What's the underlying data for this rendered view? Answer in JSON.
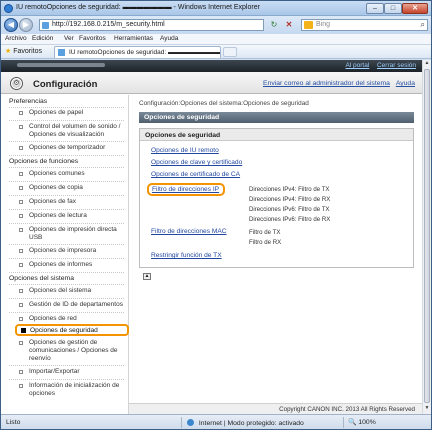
{
  "window": {
    "title": "IU remotoOpciones de seguridad: ▬▬▬▬▬▬▬ - Windows Internet Explorer",
    "min": "–",
    "max": "□",
    "close": "✕"
  },
  "address": {
    "back": "◀",
    "forward": "▶",
    "url": "http://192.168.0.215/m_security.html",
    "refresh": "↻",
    "stop": "✕",
    "search_placeholder": "Bing",
    "search_icon": "⌕"
  },
  "menu": [
    "Archivo",
    "Edición",
    "Ver",
    "Favoritos",
    "Herramientas",
    "Ayuda"
  ],
  "favorites": {
    "label": "Favoritos",
    "tab_title": "IU remotoOpciones de seguridad: ▬▬▬▬▬▬▬▬"
  },
  "topbar": {
    "portal": "Al portal",
    "logout": "Cerrar sesión"
  },
  "app": {
    "title": "Configuración",
    "email_admin": "Enviar correo al administrador del sistema",
    "help": "Ayuda"
  },
  "nav": {
    "preferences": "Preferencias",
    "paper": "Opciones de papel",
    "volume": "Control del volumen de sonido / Opciones de visualización",
    "timer": "Opciones de temporizador",
    "function_settings": "Opciones de funciones",
    "common": "Opciones comunes",
    "copy": "Opciones de copia",
    "fax": "Opciones de fax",
    "read": "Opciones de lectura",
    "usb": "Opciones de impresión directa USB",
    "printer": "Opciones de impresora",
    "reports": "Opciones de informes",
    "system_settings": "Opciones del sistema",
    "system": "Opciones del sistema",
    "dept_id": "Gestión de ID de departamentos",
    "network": "Opciones de red",
    "security": "Opciones de seguridad",
    "comm_mgmt": "Opciones de gestión de comunicaciones / Opciones de reenvío",
    "import_export": "Importar/Exportar",
    "init_info": "Información de inicialización de opciones"
  },
  "content": {
    "breadcrumb": "Configuración:Opciones del sistema:Opciones de seguridad",
    "page_title": "Opciones de seguridad",
    "box_title": "Opciones de seguridad",
    "links": {
      "remote_ui": "Opciones de IU remoto",
      "key_cert": "Opciones de clave y certificado",
      "ca_cert": "Opciones de certificado de CA",
      "ip_filter": "Filtro de direcciones IP",
      "mac_filter": "Filtro de direcciones MAC",
      "restrict_tx": "Restringir función de TX"
    },
    "ip_filters": [
      "Direcciones IPv4: Filtro de TX",
      "Direcciones IPv4: Filtro de RX",
      "Direcciones IPv6: Filtro de TX",
      "Direcciones IPv6: Filtro de RX"
    ],
    "mac_filters": [
      "Filtro de TX",
      "Filtro de RX"
    ],
    "copyright": "Copyright CANON INC. 2013 All Rights Reserved"
  },
  "status": {
    "left": "Listo",
    "zone": "Internet | Modo protegido: activado",
    "zoom": "🔍 100%"
  }
}
